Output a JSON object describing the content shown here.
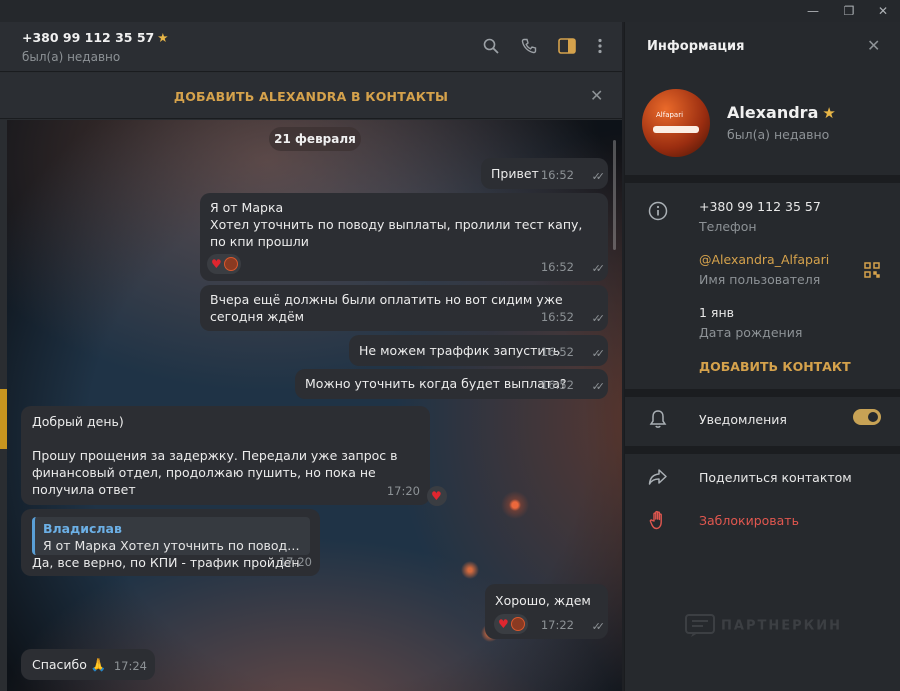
{
  "window": {
    "minimize": "—",
    "maximize": "❐",
    "close": "✕"
  },
  "header": {
    "title": "+380 99 112 35 57",
    "status": "был(а) недавно",
    "icons": [
      "search-icon",
      "phone-icon",
      "sidebar-icon",
      "more-icon"
    ]
  },
  "banner": {
    "text": "ДОБАВИТЬ ALEXANDRA В КОНТАКТЫ"
  },
  "date": "21 февраля",
  "messages": [
    {
      "dir": "out",
      "text": "Привет",
      "time": "16:52"
    },
    {
      "dir": "out",
      "text": "Я от Марка\nХотел уточнить по поводу выплаты, пролили тест капу, по кпи прошли",
      "time": "16:52",
      "reactions": [
        "heart",
        "avatar"
      ]
    },
    {
      "dir": "out",
      "text": "Вчера ещё должны были оплатить но вот сидим уже сегодня ждём",
      "time": "16:52"
    },
    {
      "dir": "out",
      "text": "Не можем траффик запустить",
      "time": "16:52"
    },
    {
      "dir": "out",
      "text": "Можно уточнить когда будет выплата?",
      "time": "16:52"
    },
    {
      "dir": "in",
      "text": "Добрый день)\n\nПрошу прощения за задержку. Передали уже запрос в финансовый отдел, продолжаю пушить, но пока не получила ответ",
      "time": "17:20",
      "reactions": [
        "heart"
      ]
    },
    {
      "dir": "in",
      "reply_name": "Владислав",
      "reply_text": "Я от Марка  Хотел уточнить по поводу выплаты, пролили тест капу, по кпи прошли",
      "text": "Да, все верно, по КПИ - трафик пройден",
      "time": "17:20"
    },
    {
      "dir": "out",
      "text": "Хорошо, ждем",
      "time": "17:22",
      "reactions": [
        "heart",
        "avatar"
      ]
    },
    {
      "dir": "in",
      "text": "Спасибо 🙏",
      "time": "17:24"
    }
  ],
  "panel": {
    "title": "Информация",
    "name": "Alexandra",
    "seen": "был(а) недавно",
    "avatar_logo": "Alfapari",
    "phone": "+380 99 112 35 57",
    "phone_label": "Телефон",
    "username": "@Alexandra_Alfapari",
    "username_label": "Имя пользователя",
    "birthday": "1 янв",
    "birthday_label": "Дата рождения",
    "add_contact": "ДОБАВИТЬ КОНТАКТ",
    "notifications": "Уведомления",
    "notifications_on": true,
    "share": "Поделиться контактом",
    "block": "Заблокировать"
  },
  "watermark": "ПАРТНЕРКИН",
  "colors": {
    "accent": "#d5a24c",
    "danger": "#e0574f",
    "reply": "#6cb0e6",
    "heart": "#e0262f"
  }
}
